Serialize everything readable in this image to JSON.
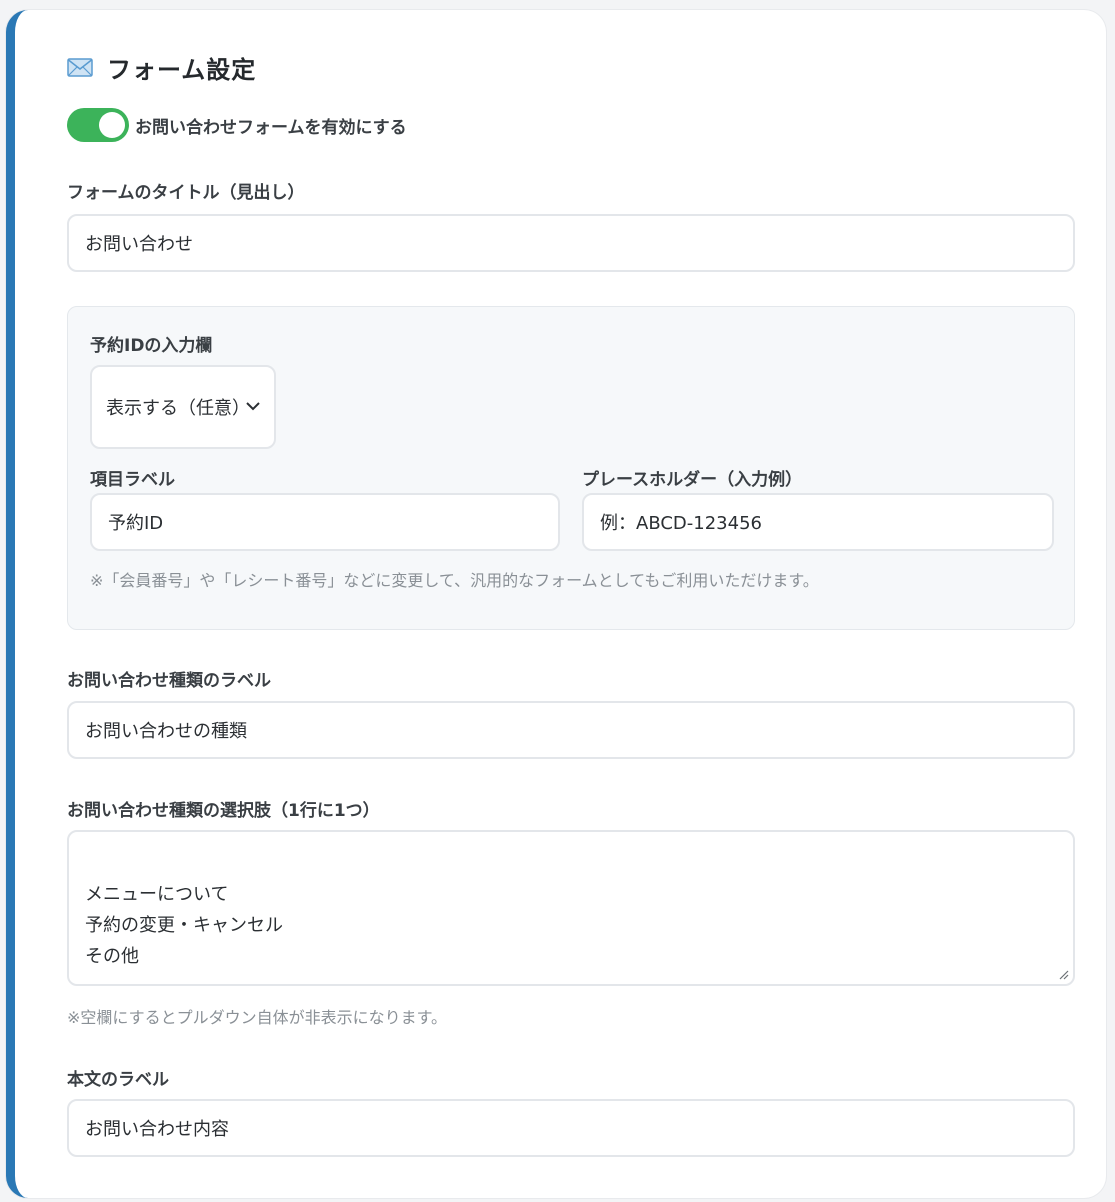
{
  "section": {
    "title": "フォーム設定",
    "icon": "envelope-icon"
  },
  "toggle": {
    "label": "お問い合わせフォームを有効にする",
    "enabled": true,
    "color": "#3cb35a"
  },
  "form_title": {
    "label": "フォームのタイトル（見出し）",
    "value": "お問い合わせ"
  },
  "reservation": {
    "heading": "予約IDの入力欄",
    "select_value": "表示する（任意）",
    "item_label": {
      "label": "項目ラベル",
      "value": "予約ID"
    },
    "placeholder": {
      "label": "プレースホルダー（入力例）",
      "value": "例：ABCD-123456"
    },
    "note": "※「会員番号」や「レシート番号」などに変更して、汎用的なフォームとしてもご利用いただけます。"
  },
  "inquiry_type": {
    "label": "お問い合わせ種類のラベル",
    "value": "お問い合わせの種類"
  },
  "inquiry_options": {
    "label": "お問い合わせ種類の選択肢（1行に1つ）",
    "value": "メニューについて\n予約の変更・キャンセル\nその他",
    "note": "※空欄にするとプルダウン自体が非表示になります。"
  },
  "body_label": {
    "label": "本文のラベル",
    "value": "お問い合わせ内容"
  },
  "colors": {
    "accent": "#2a78b5",
    "toggle_on": "#3cb35a"
  }
}
